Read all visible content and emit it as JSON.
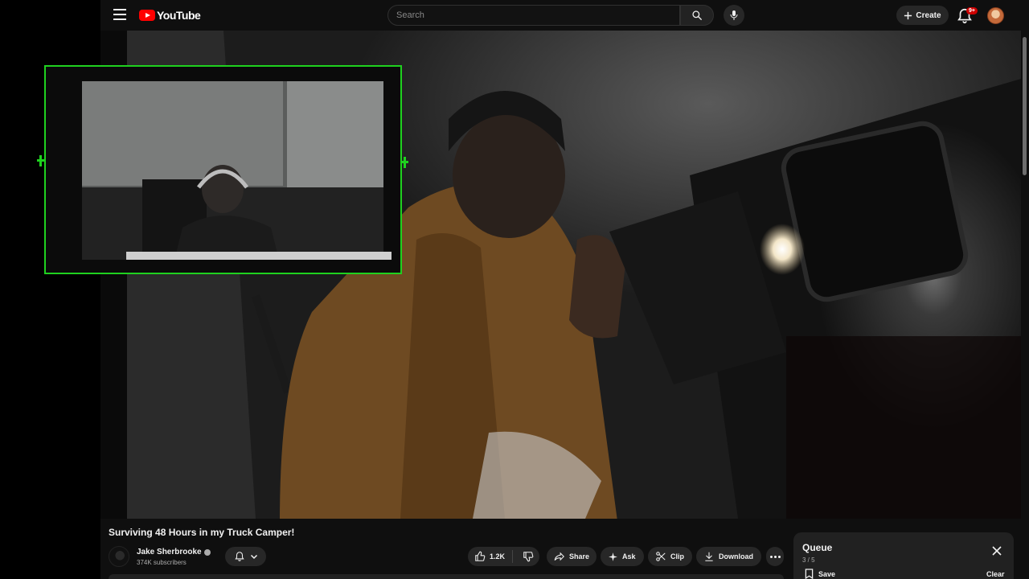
{
  "masthead": {
    "logo_text": "YouTube",
    "search_placeholder": "Search",
    "create_label": "Create",
    "notification_badge": "9+"
  },
  "video": {
    "title": "Surviving 48 Hours in my Truck Camper!",
    "channel_name": "Jake Sherbrooke",
    "subscribers": "374K subscribers"
  },
  "actions": {
    "like_count": "1.2K",
    "share_label": "Share",
    "ask_label": "Ask",
    "clip_label": "Clip",
    "download_label": "Download"
  },
  "queue": {
    "title": "Queue",
    "position": "3 / 5",
    "save_label": "Save",
    "clear_label": "Clear"
  },
  "colors": {
    "brand_red": "#ff0000",
    "overlay_border": "#1fd11f",
    "background": "#0f0f0f"
  }
}
